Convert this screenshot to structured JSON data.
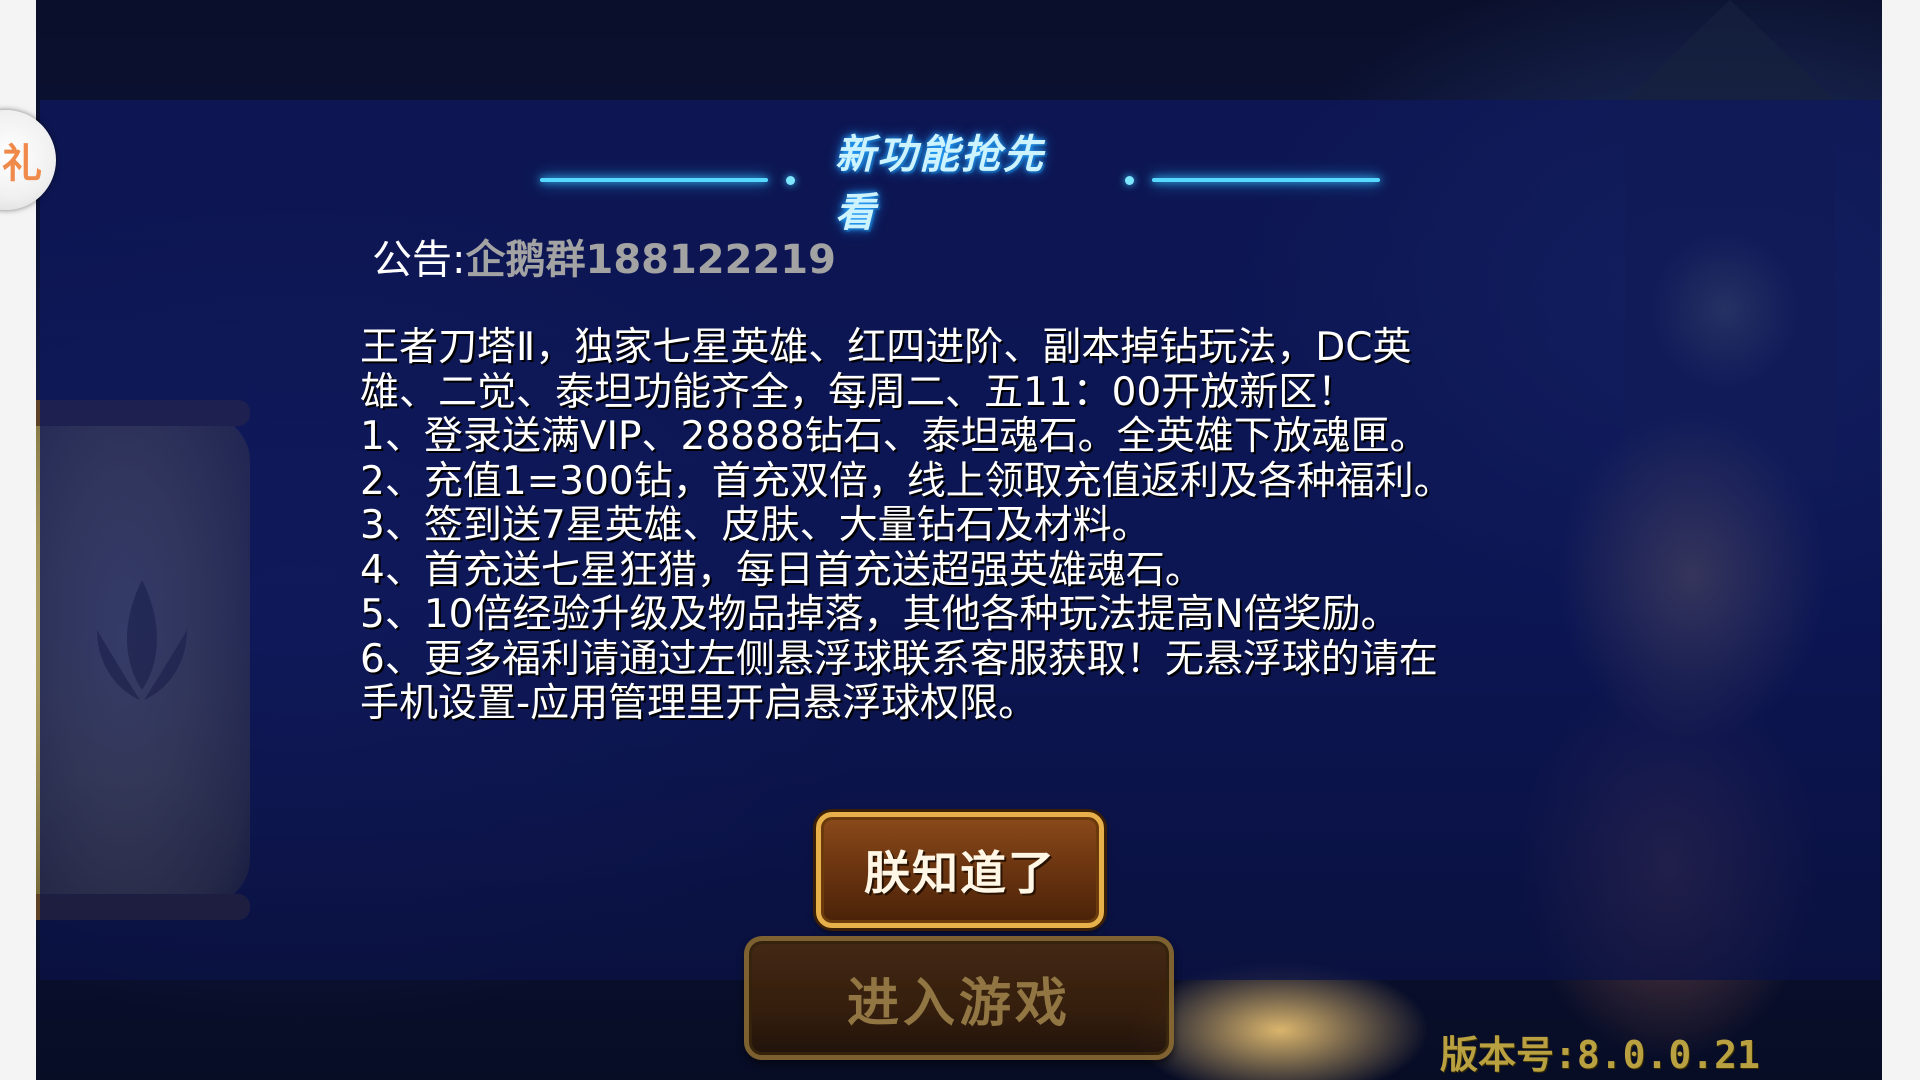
{
  "dialog": {
    "title": "新功能抢先看",
    "notice_label": "公告:",
    "notice_contact": "企鹅群188122219",
    "body_lines": [
      " 王者刀塔Ⅱ，独家七星英雄、红四进阶、副本掉钻玩法，DC英",
      "雄、二觉、泰坦功能齐全，每周二、五11：00开放新区！",
      "1、登录送满VIP、28888钻石、泰坦魂石。全英雄下放魂匣。",
      "2、充值1=300钻，首充双倍，线上领取充值返利及各种福利。",
      "3、签到送7星英雄、皮肤、大量钻石及材料。",
      "4、首充送七星狂猎，每日首充送超强英雄魂石。",
      "5、10倍经验升级及物品掉落，其他各种玩法提高N倍奖励。",
      "6、更多福利请通过左侧悬浮球联系客服获取！无悬浮球的请在",
      "手机设置-应用管理里开启悬浮球权限。"
    ],
    "ok_button": "朕知道了"
  },
  "enter_button": "进入游戏",
  "version": {
    "label": "版本号:",
    "number": "8.0.0.21"
  },
  "float_ball": {
    "glyph": "礼"
  },
  "colors": {
    "title_glow": "#56d8ff",
    "button_border": "#e8b04a",
    "panel": "#0e185c",
    "version_text": "#b9a040"
  }
}
